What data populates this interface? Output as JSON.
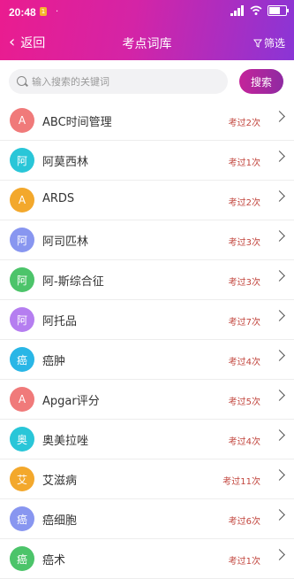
{
  "status_bar": {
    "time": "20:48",
    "notif_badge": "1",
    "battery_label": ""
  },
  "nav": {
    "back_label": "返回",
    "title": "考点词库",
    "filter_label": "筛选"
  },
  "search": {
    "placeholder": "输入搜索的关键词",
    "value": "",
    "button_label": "搜索"
  },
  "colors": {
    "header_start": "#ea1c8f",
    "header_end": "#8a35d6",
    "count_text": "#c2453d"
  },
  "items": [
    {
      "initial": "A",
      "name": "ABC时间管理",
      "count": "考过2次",
      "color": "#f07a7a"
    },
    {
      "initial": "阿",
      "name": "阿莫西林",
      "count": "考过1次",
      "color": "#29c6d8"
    },
    {
      "initial": "A",
      "name": "ARDS",
      "count": "考过2次",
      "color": "#f3a82c"
    },
    {
      "initial": "阿",
      "name": "阿司匹林",
      "count": "考过3次",
      "color": "#8896f0"
    },
    {
      "initial": "阿",
      "name": "阿-斯综合征",
      "count": "考过3次",
      "color": "#4cc46a"
    },
    {
      "initial": "阿",
      "name": "阿托品",
      "count": "考过7次",
      "color": "#b57ef0"
    },
    {
      "initial": "癌",
      "name": "癌肿",
      "count": "考过4次",
      "color": "#29b6e6"
    },
    {
      "initial": "A",
      "name": "Apgar评分",
      "count": "考过5次",
      "color": "#f07a7a"
    },
    {
      "initial": "奥",
      "name": "奥美拉唑",
      "count": "考过4次",
      "color": "#29c6d8"
    },
    {
      "initial": "艾",
      "name": "艾滋病",
      "count": "考过11次",
      "color": "#f3a82c"
    },
    {
      "initial": "癌",
      "name": "癌细胞",
      "count": "考过6次",
      "color": "#8896f0"
    },
    {
      "initial": "癌",
      "name": "癌术",
      "count": "考过1次",
      "color": "#4cc46a"
    }
  ]
}
